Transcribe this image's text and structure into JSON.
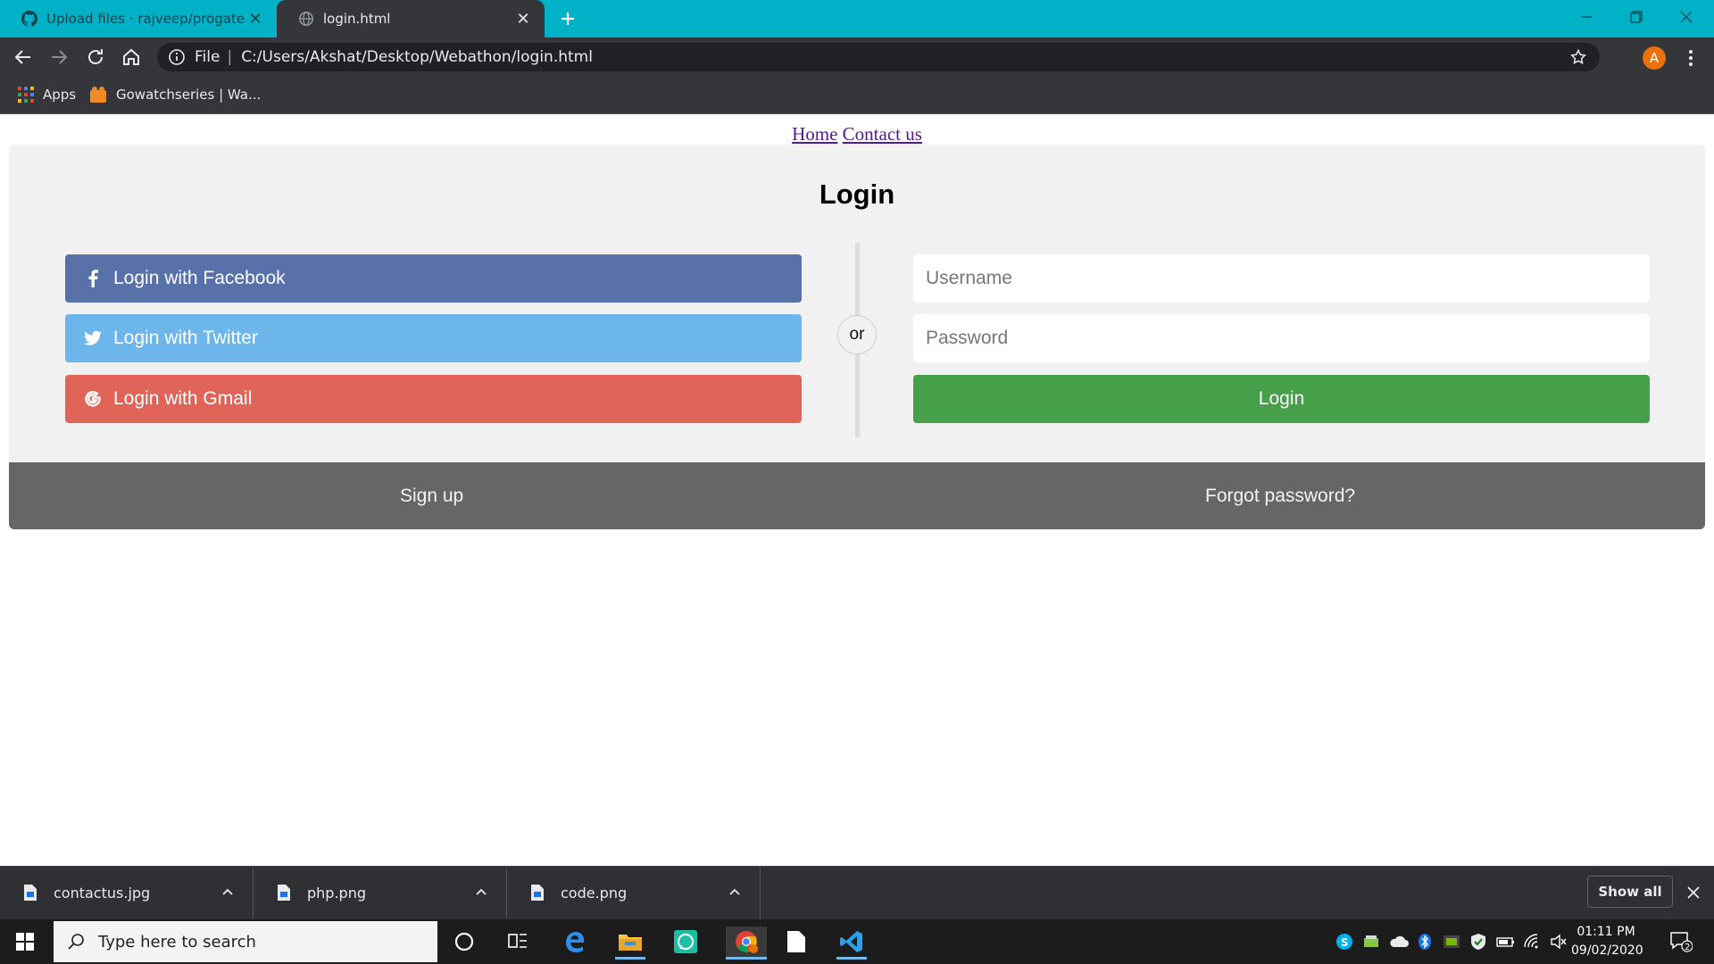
{
  "browser": {
    "tabs": [
      {
        "title": "Upload files · rajveep/progate.git",
        "active": false,
        "icon": "github-icon"
      },
      {
        "title": "login.html",
        "active": true,
        "icon": "globe-icon"
      }
    ],
    "address": {
      "scheme_label": "File",
      "url": "C:/Users/Akshat/Desktop/Webathon/login.html"
    },
    "profile_initial": "A",
    "bookmarks": [
      {
        "label": "Apps",
        "icon": "apps-grid-icon"
      },
      {
        "label": "Gowatchseries | Wa...",
        "icon": "gowatchseries-icon"
      }
    ]
  },
  "page": {
    "nav": {
      "home": "Home",
      "contact": "Contact us"
    },
    "title": "Login",
    "social": {
      "facebook": "Login with Facebook",
      "twitter": "Login with Twitter",
      "gmail": "Login with Gmail"
    },
    "divider_text": "or",
    "form": {
      "username_placeholder": "Username",
      "password_placeholder": "Password",
      "submit_label": "Login"
    },
    "footer": {
      "signup": "Sign up",
      "forgot": "Forgot password?"
    }
  },
  "downloads": {
    "items": [
      "contactus.jpg",
      "php.png",
      "code.png"
    ],
    "show_all": "Show all"
  },
  "taskbar": {
    "search_placeholder": "Type here to search",
    "time": "01:11 PM",
    "date": "09/02/2020",
    "notification_count": "2"
  },
  "colors": {
    "tabbar": "#00b1c7",
    "facebook": "#5871a8",
    "twitter": "#6cb6ec",
    "gmail": "#e06558",
    "login_button": "#46a049",
    "footer_bar": "#666666",
    "card": "#f1f1f1"
  }
}
